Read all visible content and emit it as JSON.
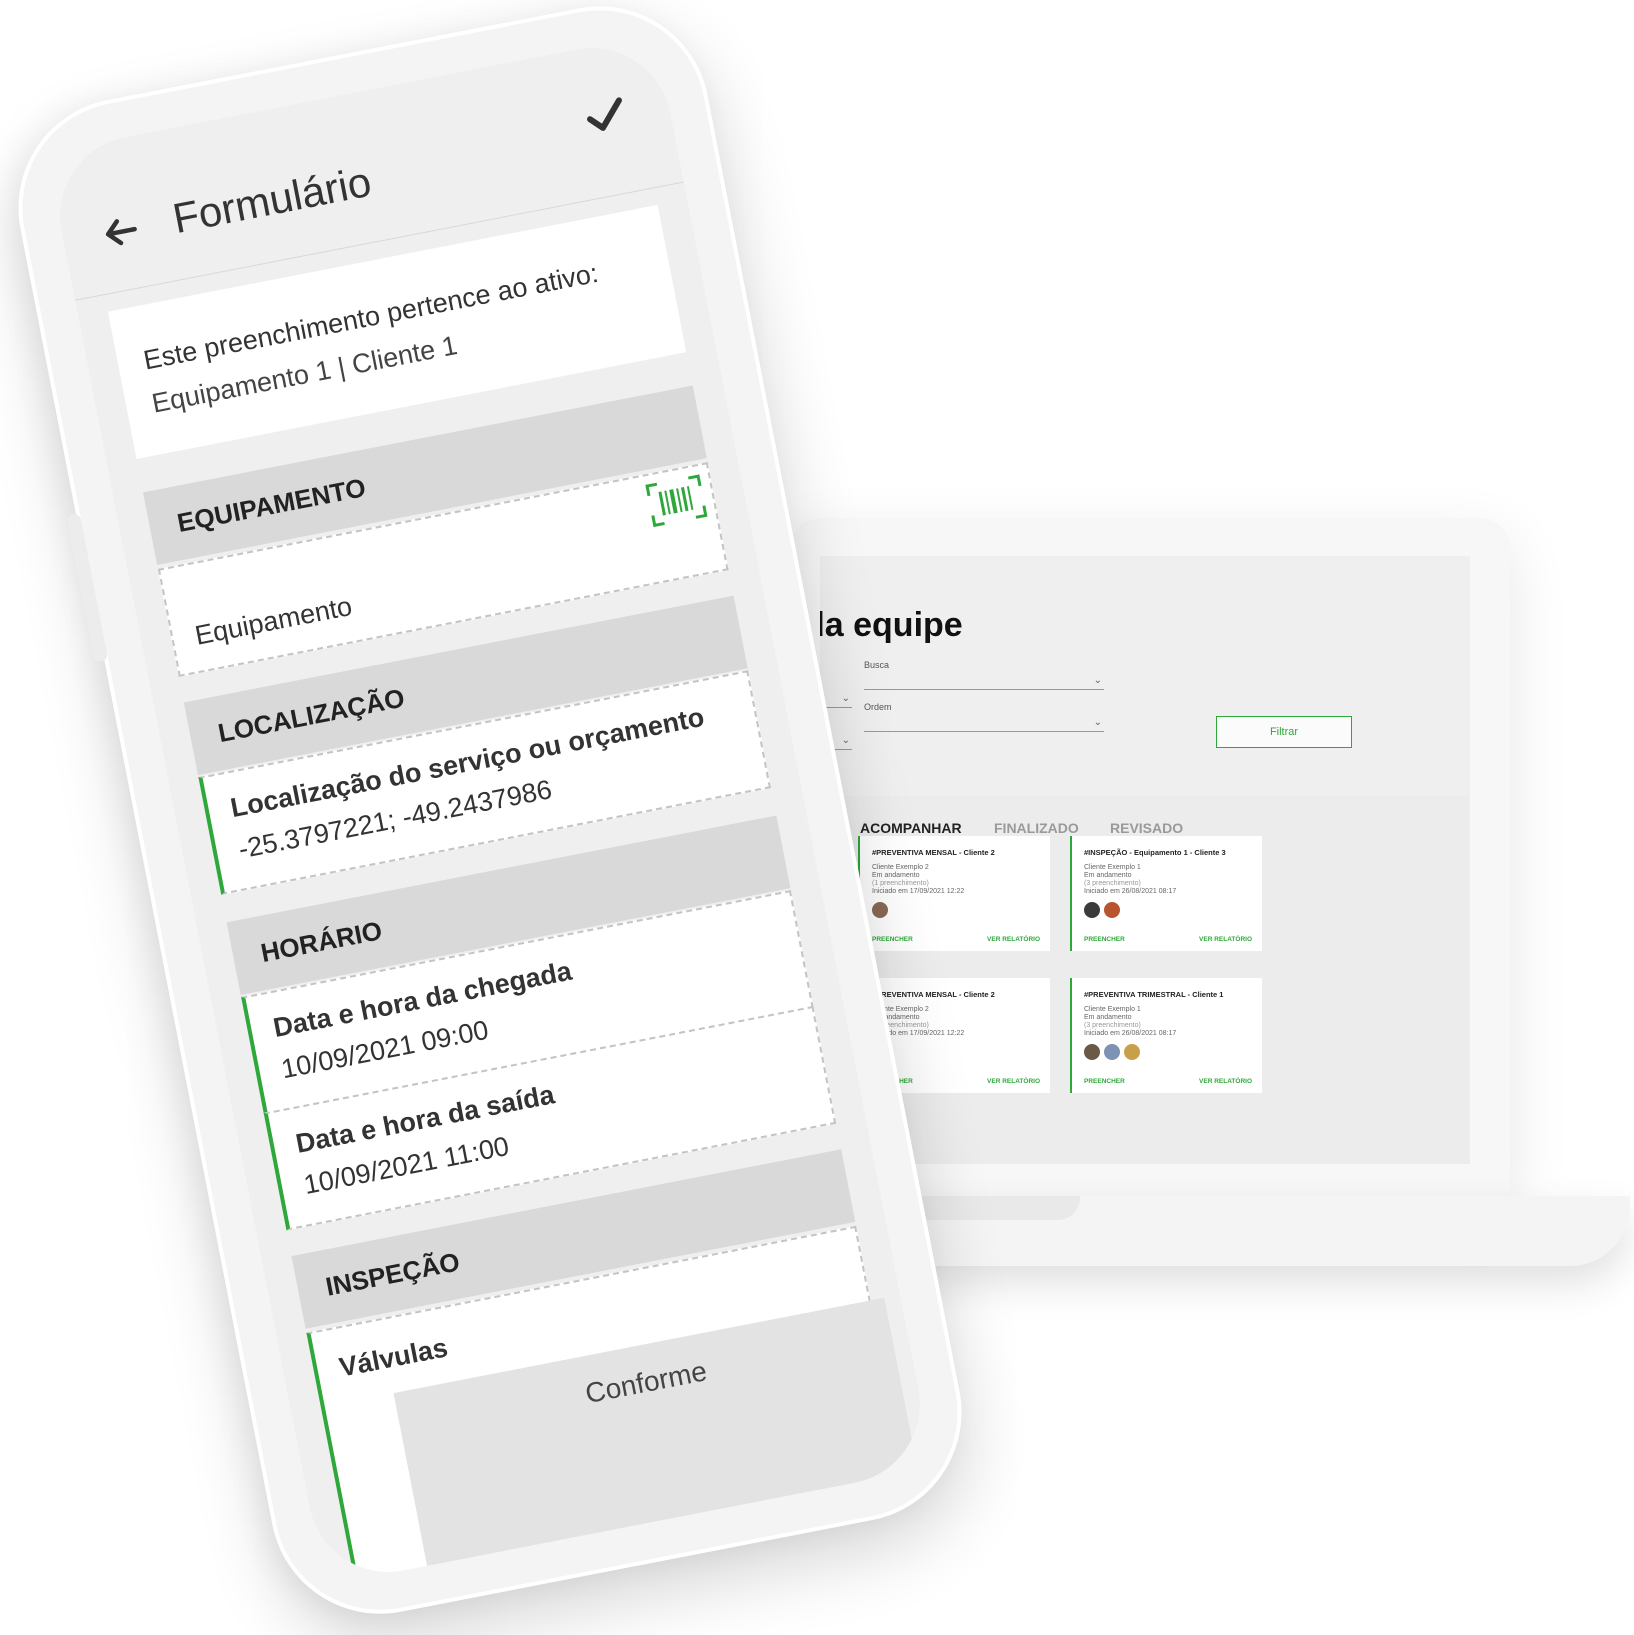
{
  "laptop": {
    "page_title": "da equipe",
    "filters": {
      "busca_label": "Busca",
      "ordem_label": "Ordem",
      "filter_button": "Filtrar"
    },
    "tabs": [
      {
        "label": "ACOMPANHAR",
        "active": true
      },
      {
        "label": "FINALIZADO",
        "active": false
      },
      {
        "label": "REVISADO",
        "active": false
      }
    ],
    "cards": [
      {
        "title": "#PREVENTIVA MENSAL - Cliente 2",
        "client": "Cliente Exemplo 2",
        "status": "Em andamento",
        "fills": "(1 preenchimento)",
        "started": "Iniciado em 17/09/2021 12:22",
        "action_left": "PREENCHER",
        "action_right": "VER RELATÓRIO"
      },
      {
        "title": "#INSPEÇÃO - Equipamento 1 - Cliente 3",
        "client": "Cliente Exemplo 1",
        "status": "Em andamento",
        "fills": "(3 preenchimento)",
        "started": "Iniciado em 26/08/2021 08:17",
        "action_left": "PREENCHER",
        "action_right": "VER RELATÓRIO"
      },
      {
        "title": "#PREVENTIVA MENSAL - Cliente 2",
        "client": "Cliente Exemplo 2",
        "status": "Em andamento",
        "fills": "(1 preenchimento)",
        "started": "Iniciado em 17/09/2021 12:22",
        "action_left": "PREENCHER",
        "action_right": "VER RELATÓRIO"
      },
      {
        "title": "#PREVENTIVA TRIMESTRAL - Cliente 1",
        "client": "Cliente Exemplo 1",
        "status": "Em andamento",
        "fills": "(3 preenchimento)",
        "started": "Iniciado em 26/08/2021 08:17",
        "action_left": "PREENCHER",
        "action_right": "VER RELATÓRIO"
      }
    ]
  },
  "phone": {
    "appbar": {
      "title": "Formulário",
      "back_icon": "arrow-left-icon",
      "confirm_icon": "check-icon"
    },
    "info": {
      "line1": "Este preenchimento pertence ao ativo:",
      "line2": "Equipamento 1 | Cliente 1"
    },
    "sections": {
      "equipamento": "EQUIPAMENTO",
      "localizacao": "LOCALIZAÇÃO",
      "horario": "HORÁRIO",
      "inspecao": "INSPEÇÃO"
    },
    "fields": {
      "equipamento_placeholder": "Equipamento",
      "location_label": "Localização do serviço ou orçamento",
      "location_value": "-25.3797221; -49.2437986",
      "arrival_label": "Data e hora da chegada",
      "arrival_value": "10/09/2021 09:00",
      "departure_label": "Data e hora da saída",
      "departure_value": "10/09/2021 11:00",
      "valvulas_label": "Válvulas",
      "valvulas_value": "Conforme"
    },
    "colors": {
      "accent": "#2ea83a",
      "section_bg": "#d9d9d9"
    }
  }
}
